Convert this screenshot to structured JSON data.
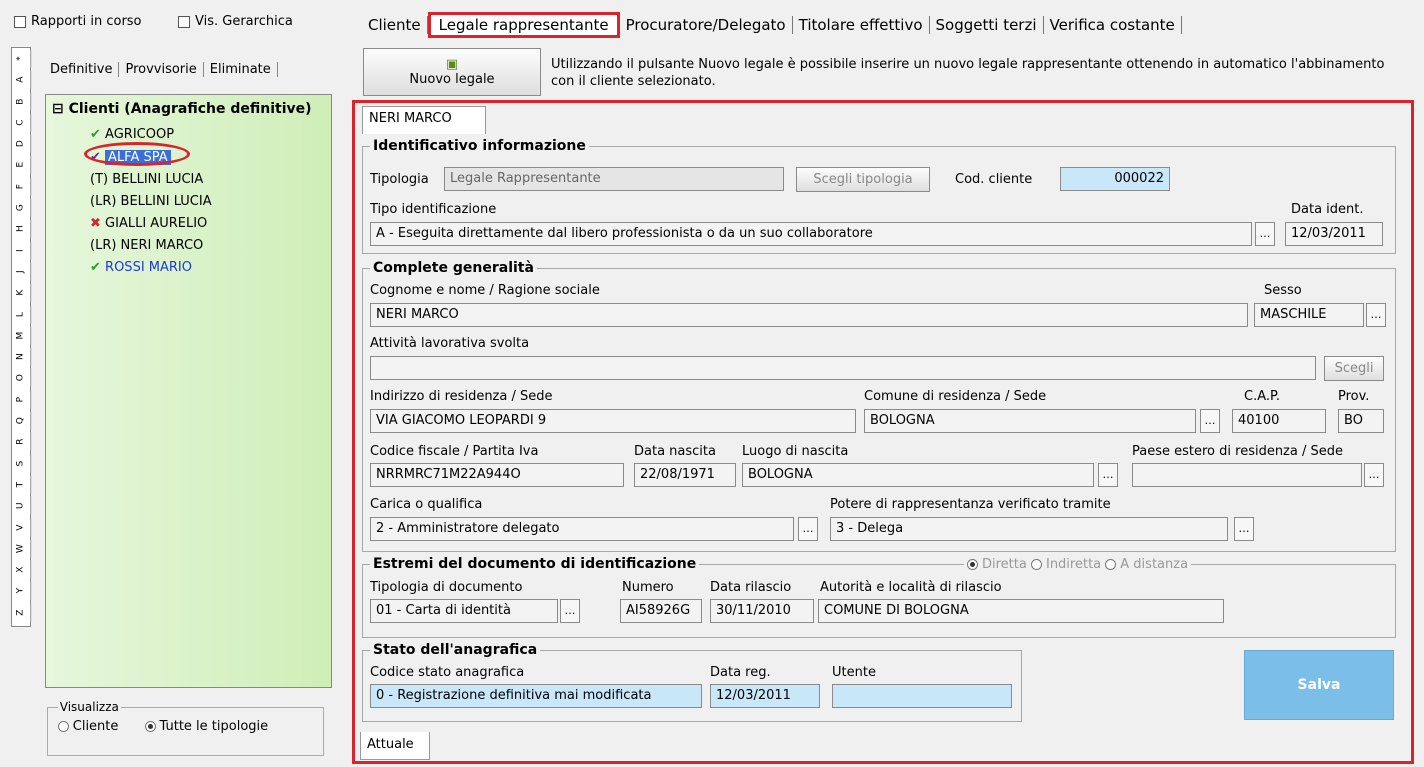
{
  "top": {
    "rapporti": "Rapporti in corso",
    "gerarchica": "Vis. Gerarchica"
  },
  "alphabet": [
    "*",
    "A",
    "B",
    "C",
    "D",
    "E",
    "F",
    "G",
    "H",
    "I",
    "J",
    "K",
    "L",
    "M",
    "N",
    "O",
    "P",
    "Q",
    "R",
    "S",
    "T",
    "U",
    "V",
    "W",
    "X",
    "Y",
    "Z"
  ],
  "leftTabs": [
    "Definitive",
    "Provvisorie",
    "Eliminate"
  ],
  "tree": {
    "root": "Clienti (Anagrafiche definitive)",
    "items": [
      "AGRICOOP",
      "ALFA SPA",
      "(T) BELLINI LUCIA",
      "(LR) BELLINI LUCIA",
      "GIALLI AURELIO",
      "(LR) NERI MARCO",
      "ROSSI MARIO"
    ]
  },
  "visualizza": {
    "legend": "Visualizza",
    "cliente": "Cliente",
    "tutte": "Tutte le tipologie"
  },
  "mainTabs": [
    "Cliente",
    "Legale rappresentante",
    "Procuratore/Delegato",
    "Titolare effettivo",
    "Soggetti terzi",
    "Verifica costante"
  ],
  "nuovo": {
    "label": "Nuovo legale",
    "info": "Utilizzando il pulsante Nuovo legale è possibile inserire un nuovo legale rappresentante ottenendo in automatico l'abbinamento con il cliente selezionato."
  },
  "recordTab": "NERI MARCO",
  "ident": {
    "title": "Identificativo informazione",
    "tipologiaLabel": "Tipologia",
    "tipologia": "Legale Rappresentante",
    "scegliTipologia": "Scegli tipologia",
    "codLabel": "Cod. cliente",
    "cod": "000022",
    "tipoIdLabel": "Tipo identificazione",
    "tipoId": "A - Eseguita direttamente dal libero professionista o da un suo collaboratore",
    "dataIdLabel": "Data ident.",
    "dataId": "12/03/2011"
  },
  "gen": {
    "title": "Complete generalità",
    "nomeLabel": "Cognome e nome / Ragione sociale",
    "nome": "NERI MARCO",
    "sessoLabel": "Sesso",
    "sesso": "MASCHILE",
    "attivitaLabel": "Attività lavorativa svolta",
    "scegli": "Scegli",
    "indirizzoLabel": "Indirizzo di residenza / Sede",
    "indirizzo": "VIA GIACOMO LEOPARDI 9",
    "comuneLabel": "Comune di residenza / Sede",
    "comune": "BOLOGNA",
    "capLabel": "C.A.P.",
    "cap": "40100",
    "provLabel": "Prov.",
    "prov": "BO",
    "cfLabel": "Codice fiscale / Partita Iva",
    "cf": "NRRMRC71M22A944O",
    "nascitaLabel": "Data nascita",
    "nascita": "22/08/1971",
    "luogoLabel": "Luogo di nascita",
    "luogo": "BOLOGNA",
    "paeseLabel": "Paese estero di residenza / Sede",
    "caricaLabel": "Carica o qualifica",
    "carica": "2 - Amministratore delegato",
    "potereLabel": "Potere di rappresentanza verificato tramite",
    "potere": "3 - Delega"
  },
  "doc": {
    "title": "Estremi del documento di identificazione",
    "diretta": "Diretta",
    "indiretta": "Indiretta",
    "distanza": "A distanza",
    "tipoLabel": "Tipologia di documento",
    "tipo": "01 - Carta di identità",
    "numeroLabel": "Numero",
    "numero": "AI58926G",
    "rilascioLabel": "Data rilascio",
    "rilascio": "30/11/2010",
    "autoritaLabel": "Autorità e località di rilascio",
    "autorita": "COMUNE DI BOLOGNA"
  },
  "stato": {
    "title": "Stato dell'anagrafica",
    "codiceLabel": "Codice stato anagrafica",
    "codice": "0 - Registrazione definitiva mai modificata",
    "dataLabel": "Data reg.",
    "data": "12/03/2011",
    "utenteLabel": "Utente",
    "utente": ""
  },
  "salva": "Salva",
  "bottomTab": "Attuale"
}
